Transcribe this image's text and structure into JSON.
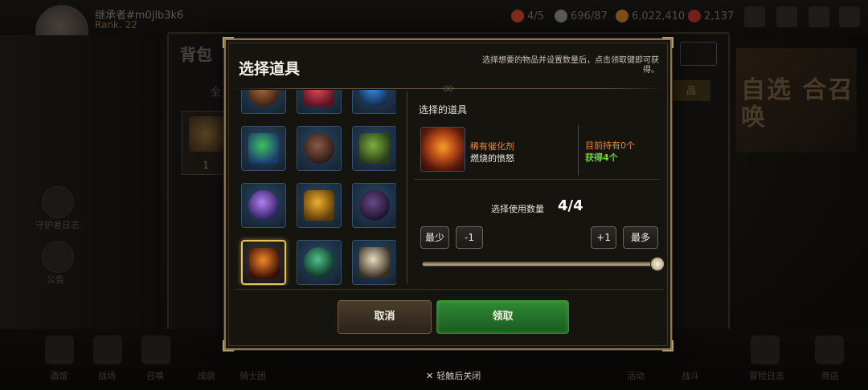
{
  "background": {
    "player": {
      "name": "继承者#m0jlb3k6",
      "rank": "Rank. 22"
    },
    "resources": [
      {
        "icon": "stamina-icon",
        "value": "4/5",
        "color": "#c0482a"
      },
      {
        "icon": "dagger-icon",
        "value": "696/87",
        "color": "#8a8a8a"
      },
      {
        "icon": "gold-icon",
        "value": "6,022,410",
        "color": "#c07a28"
      },
      {
        "icon": "gem-icon",
        "value": "2,137",
        "color": "#b03030"
      }
    ],
    "panel_title": "背包",
    "tab_label": "全",
    "tab2_label": "品",
    "slot_count": "1",
    "banner_text": "自选 合召唤",
    "side_items": [
      "守护者日志",
      "公告"
    ],
    "bottom_items": [
      "酒馆",
      "战场",
      "召唤",
      "成就",
      "骑士团",
      "活动",
      "战斗",
      "冒险日志",
      "商店"
    ]
  },
  "modal": {
    "title": "选择道具",
    "hint": "选择想要的物品并设置数量后，点击领取键即可获得。",
    "items": [
      {
        "name": "item-chest",
        "c1": "#a86838",
        "c2": "#3a2010"
      },
      {
        "name": "item-red-slime",
        "c1": "#e04a5a",
        "c2": "#5a1220"
      },
      {
        "name": "item-blue-scroll",
        "c1": "#3a8ae0",
        "c2": "#10284a"
      },
      {
        "name": "item-color-orbs",
        "c1": "#40c060",
        "c2": "#1a3a70"
      },
      {
        "name": "item-ore-pile",
        "c1": "#8a5a4a",
        "c2": "#2a1814"
      },
      {
        "name": "item-green-powder",
        "c1": "#7ab040",
        "c2": "#2a3a14"
      },
      {
        "name": "item-crystal-shard",
        "c1": "#b080f0",
        "c2": "#2a1a5a"
      },
      {
        "name": "item-gold-medal",
        "c1": "#f0b030",
        "c2": "#5a3a08"
      },
      {
        "name": "item-dark-tablet",
        "c1": "#6a4a8a",
        "c2": "#1a1028"
      },
      {
        "name": "item-fire-catalyst",
        "c1": "#f08a28",
        "c2": "#3a0c06"
      },
      {
        "name": "item-jade-compass",
        "c1": "#50c090",
        "c2": "#0a3020"
      },
      {
        "name": "item-skull-bones",
        "c1": "#e8ddc0",
        "c2": "#3a3020"
      }
    ],
    "selected_index": 9,
    "selected_label": "选择的道具",
    "selected_rarity": "稀有催化剂",
    "selected_name": "燃烧的愤怒",
    "owned_text": "目前持有0个",
    "gain_text": "获得4个",
    "qty_label": "选择使用数量",
    "qty_value": "4/4",
    "qty_fraction": 1.0,
    "btn_min": "最少",
    "btn_minus": "-1",
    "btn_plus": "+1",
    "btn_max": "最多",
    "cancel": "取消",
    "confirm": "领取"
  },
  "close_hint": "轻触后关闭"
}
